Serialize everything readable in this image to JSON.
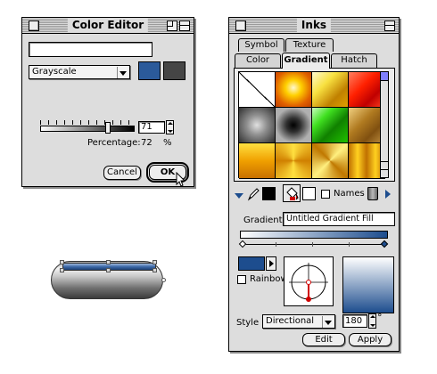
{
  "color_editor": {
    "title": "Color Editor",
    "name_value": "",
    "mode_selected": "Grayscale",
    "swatches": {
      "new": "#2b5a9a",
      "old": "#454545"
    },
    "value_field": "71",
    "percentage_label": "Percentage:",
    "percentage_value": "72",
    "percent_sign": "%",
    "slider_fraction": 0.72,
    "cancel_label": "Cancel",
    "ok_label": "OK"
  },
  "inks": {
    "title": "Inks",
    "tabs_row1": [
      "Symbol",
      "Texture"
    ],
    "tabs_row2": [
      "Color",
      "Gradient",
      "Hatch"
    ],
    "active_tab": "Gradient",
    "gradient_swatches": [
      "none",
      "orange-radial",
      "yellow-diagonal",
      "red-diagonal",
      "gray-radial",
      "gray-square",
      "green-diagonal",
      "bronze-diagonal",
      "gold-linear",
      "gold-conical",
      "gold-conical-2",
      "gold-vertical"
    ],
    "names_label": "Names",
    "gradient_label": "Gradient",
    "gradient_name": "Untitled Gradient Fill",
    "color_stops": {
      "start": "#ffffff",
      "end": "#1d4d8e"
    },
    "rainbow_label": "Rainbow",
    "style_label": "Style",
    "style_value": "Directional",
    "angle_value": "180",
    "angle_unit": "°",
    "edit_label": "Edit",
    "apply_label": "Apply"
  }
}
